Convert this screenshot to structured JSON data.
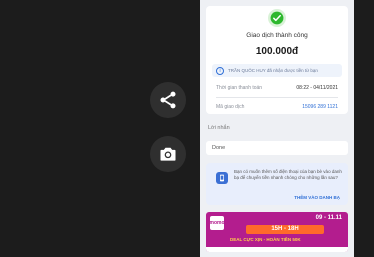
{
  "actions": {
    "share_icon": "share-icon",
    "camera_icon": "camera-icon"
  },
  "receipt": {
    "status_title": "Giao dịch thành công",
    "amount": "100.000đ",
    "note": "TRẦN QUỐC HUY đã nhận được tiền từ bạn",
    "time_label": "Thời gian thanh toán",
    "time_value": "08:22 - 04/11/2021",
    "code_label": "Mã giao dịch",
    "code_value": "15096 289 1121"
  },
  "message": {
    "label": "Lời nhắn",
    "value": "Done"
  },
  "promo_card": {
    "text": "Bạn có muốn thêm số điện thoại của bạn bè vào danh bạ để chuyển tiền nhanh chóng cho những lần sau?",
    "link": "THÊM VÀO DANH BẠ"
  },
  "banner": {
    "brand": "momo",
    "date": "09 - 11.11",
    "headline": "15H - 18H",
    "sub": "DEAL CỰC XỊN - HOÀN TIỀN 50K"
  },
  "colors": {
    "accent": "#2f6fd6",
    "success": "#2eb82e",
    "momo": "#b31d8e"
  }
}
